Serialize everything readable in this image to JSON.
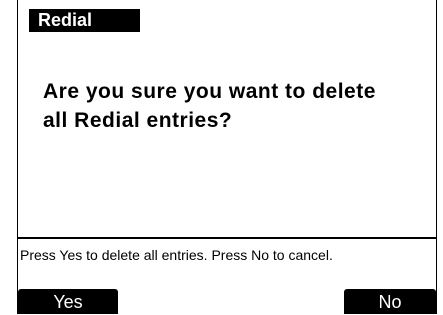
{
  "header": {
    "title": "Redial"
  },
  "dialog": {
    "question": "Are you sure you want to delete all Redial entries?"
  },
  "help": {
    "text": "Press Yes to delete all entries. Press No to cancel."
  },
  "softkeys": {
    "left_label": "Yes",
    "right_label": "No"
  },
  "colors": {
    "foreground": "#000000",
    "background": "#ffffff"
  }
}
